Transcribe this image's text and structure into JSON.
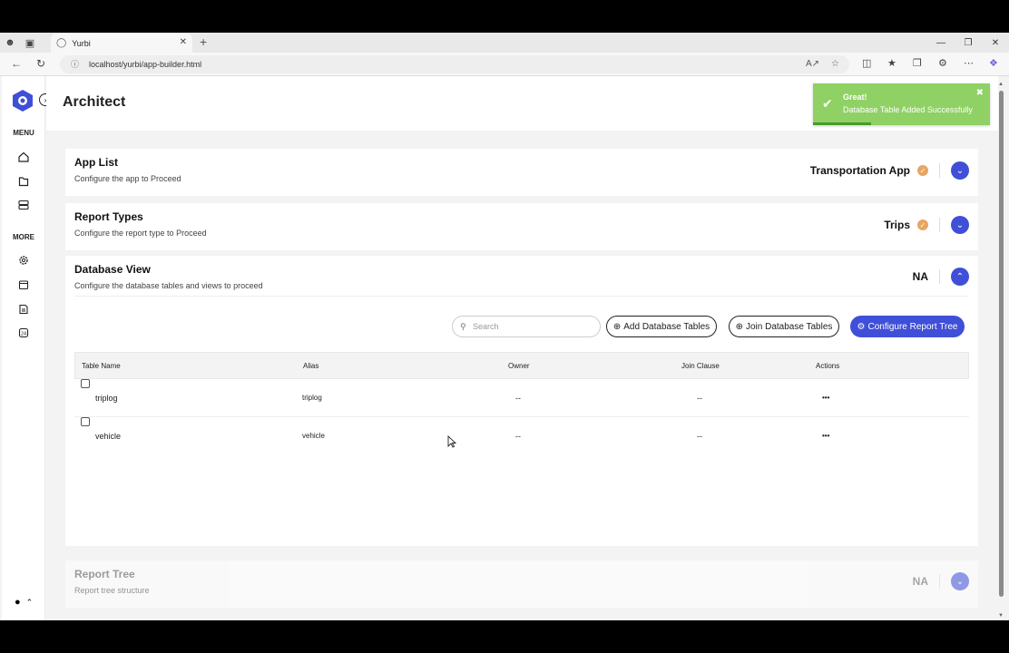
{
  "browser": {
    "tab_title": "Yurbi",
    "url": "localhost/yurbi/app-builder.html"
  },
  "sidebar": {
    "menu_label": "MENU",
    "more_label": "MORE",
    "menu_icons": [
      "home-icon",
      "folder-icon",
      "database-icon"
    ],
    "more_icons": [
      "gear-icon",
      "calendar-icon",
      "report-icon",
      "shortcut-icon"
    ]
  },
  "header": {
    "title": "Architect"
  },
  "toast": {
    "title": "Great!",
    "message": "Database Table Added Successfully"
  },
  "cards": {
    "app_list": {
      "title": "App List",
      "subtitle": "Configure the app to Proceed",
      "value": "Transportation App"
    },
    "report_types": {
      "title": "Report Types",
      "subtitle": "Configure the report type to Proceed",
      "value": "Trips"
    },
    "database_view": {
      "title": "Database View",
      "subtitle": "Configure the database tables and views to proceed",
      "value": "NA"
    },
    "report_tree": {
      "title": "Report Tree",
      "subtitle": "Report tree structure",
      "value": "NA"
    }
  },
  "database_view": {
    "search_placeholder": "Search",
    "add_button": "Add Database Tables",
    "join_button": "Join Database Tables",
    "configure_button": "Configure Report Tree",
    "columns": [
      "Table Name",
      "Alias",
      "Owner",
      "Join Clause",
      "Actions"
    ],
    "rows": [
      {
        "table_name": "triplog",
        "alias": "triplog",
        "owner": "--",
        "join_clause": "--",
        "actions": "•••"
      },
      {
        "table_name": "vehicle",
        "alias": "vehicle",
        "owner": "--",
        "join_clause": "--",
        "actions": "•••"
      }
    ]
  },
  "colors": {
    "primary": "#3f4fd8",
    "toast": "#8fd164",
    "badge": "#e8a563"
  }
}
